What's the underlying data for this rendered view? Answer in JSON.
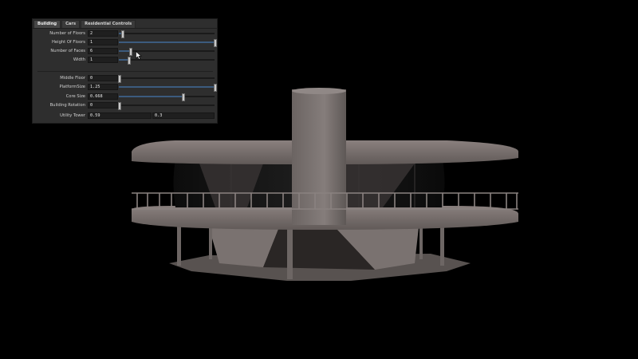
{
  "tabs": [
    {
      "label": "Building",
      "active": true
    },
    {
      "label": "Cars",
      "active": false
    },
    {
      "label": "Residential Controls",
      "active": false
    }
  ],
  "params": [
    {
      "label": "Number of Floors",
      "value": "2",
      "level": 0.03
    },
    {
      "label": "Height Of Floors",
      "value": "1",
      "level": 1.0
    },
    {
      "label": "Number of Faces",
      "value": "6",
      "level": 0.12
    },
    {
      "label": "Width",
      "value": "1",
      "level": 0.1
    }
  ],
  "params2": [
    {
      "label": "Middle Floor",
      "value": "0",
      "level": 0.0
    },
    {
      "label": "PlatformSize",
      "value": "1.25",
      "level": 1.0
    },
    {
      "label": "Core Size",
      "value": "0.668",
      "level": 0.67
    },
    {
      "label": "Building Rotation",
      "value": "0",
      "level": 0.0
    }
  ],
  "utility_tower": {
    "label": "Utility Tower",
    "value1": "0.59",
    "value2": "0.3"
  },
  "colors": {
    "panel_bg": "#2e2e2e",
    "slider_fill": "#3c5b7e",
    "viewport_bg": "#000000"
  }
}
